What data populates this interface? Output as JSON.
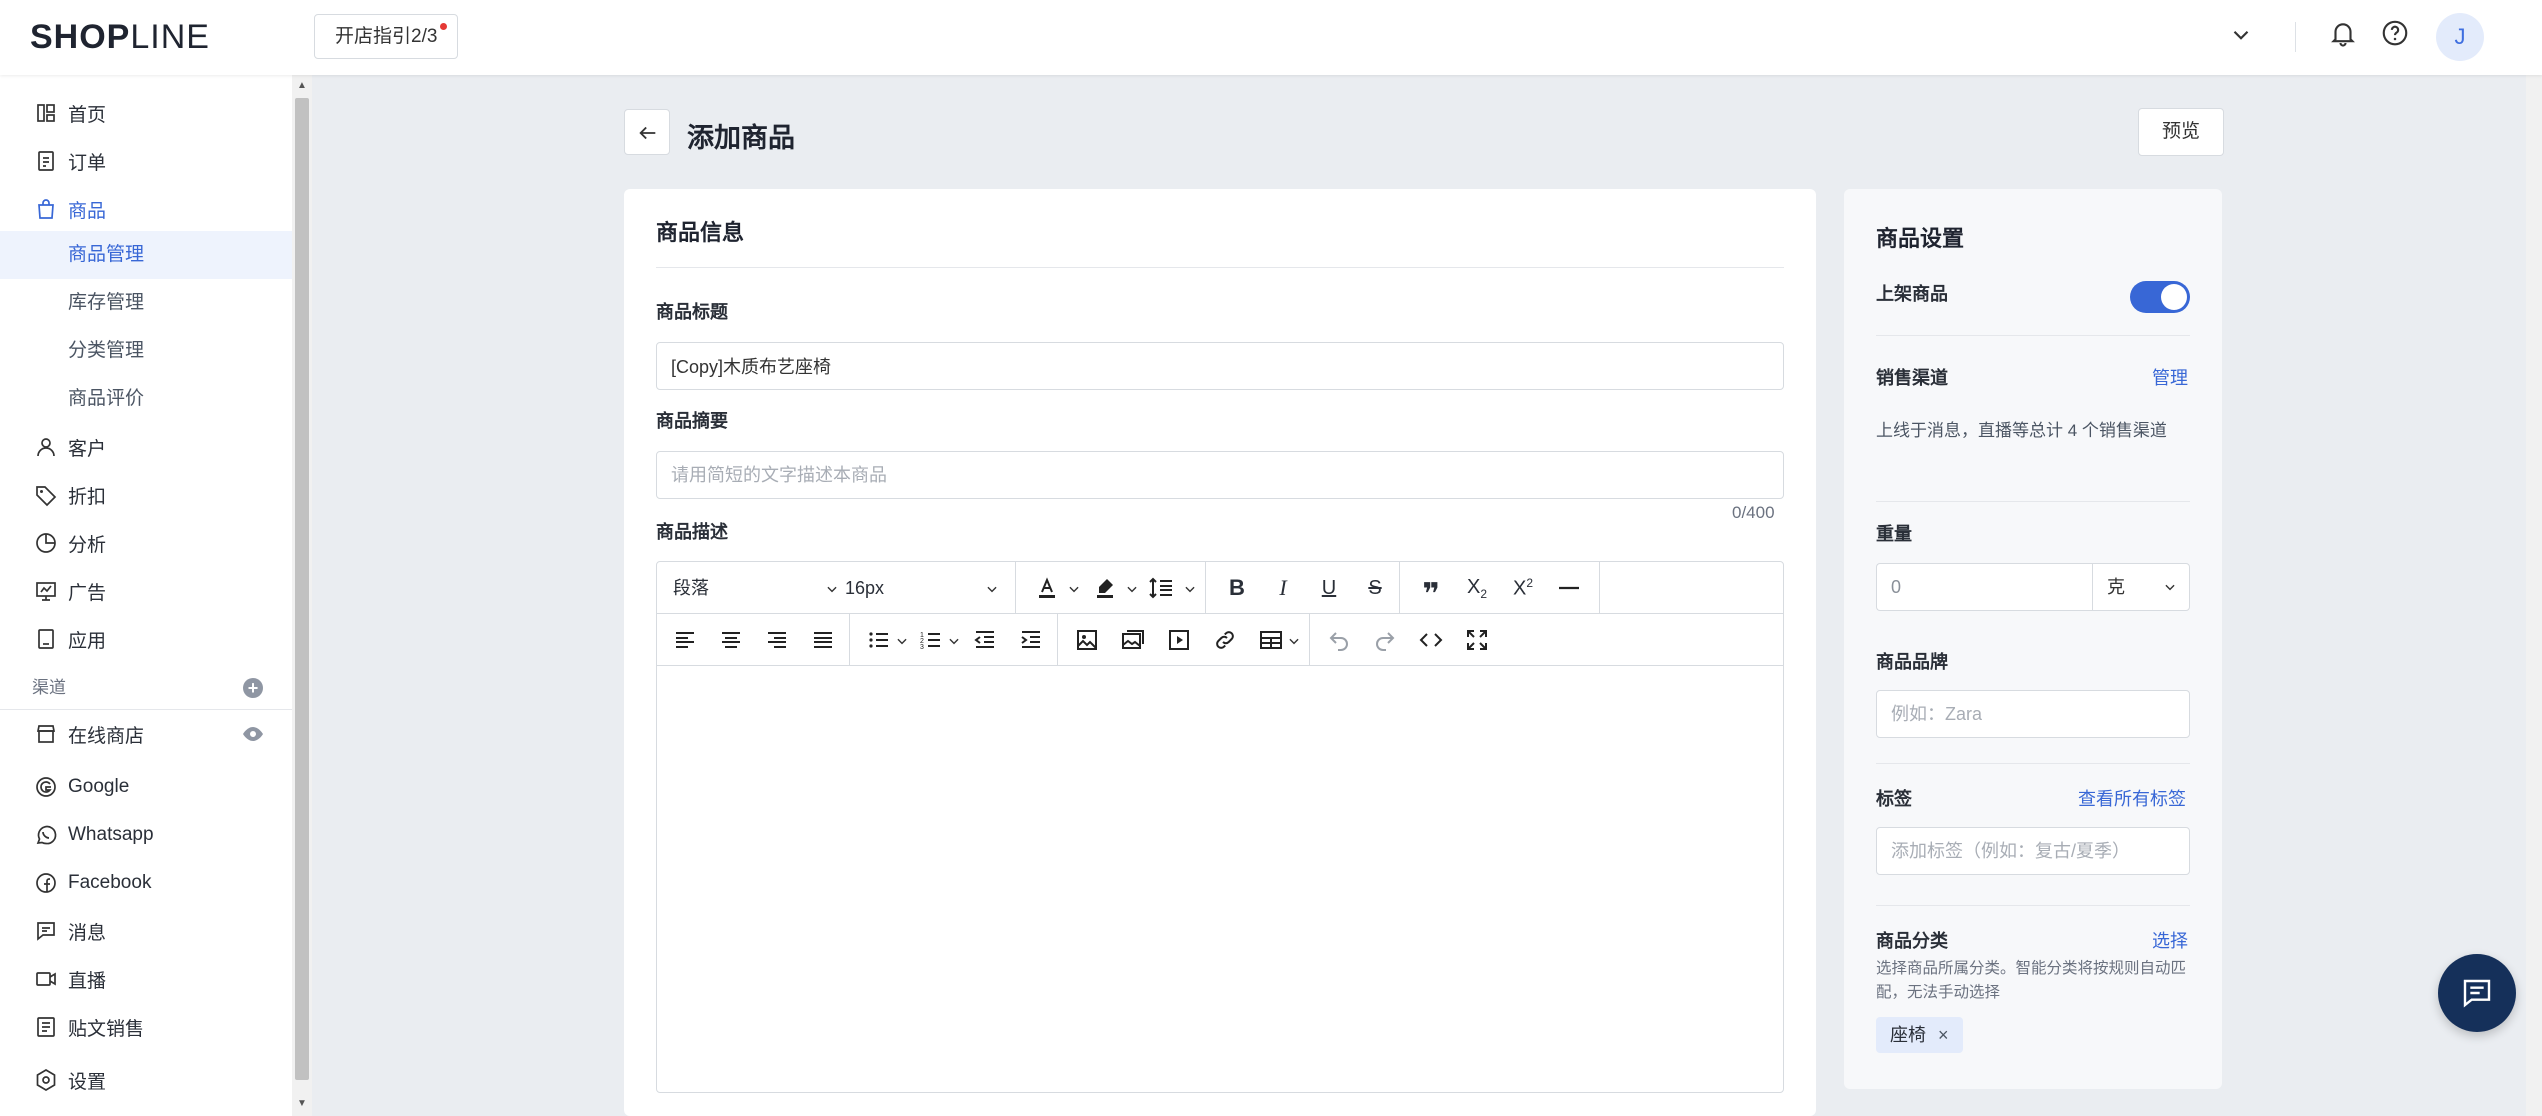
{
  "header": {
    "logo_bold": "SHOP",
    "logo_light": "LINE",
    "guide_button": "开店指引2/3",
    "avatar_initial": "J"
  },
  "sidebar": {
    "items": [
      {
        "label": "首页",
        "icon": "dashboard-icon"
      },
      {
        "label": "订单",
        "icon": "order-icon"
      },
      {
        "label": "商品",
        "icon": "bag-icon",
        "active": true
      }
    ],
    "product_sub": [
      {
        "label": "商品管理",
        "active": true
      },
      {
        "label": "库存管理"
      },
      {
        "label": "分类管理"
      },
      {
        "label": "商品评价"
      }
    ],
    "items2": [
      {
        "label": "客户",
        "icon": "user-icon"
      },
      {
        "label": "折扣",
        "icon": "tag-icon"
      },
      {
        "label": "分析",
        "icon": "pie-chart-icon"
      },
      {
        "label": "广告",
        "icon": "ads-icon"
      },
      {
        "label": "应用",
        "icon": "app-icon"
      }
    ],
    "channel_section": "渠道",
    "channels": [
      {
        "label": "在线商店",
        "icon": "store-icon"
      },
      {
        "label": "Google",
        "icon": "google-icon"
      },
      {
        "label": "Whatsapp",
        "icon": "whatsapp-icon"
      },
      {
        "label": "Facebook",
        "icon": "facebook-icon"
      },
      {
        "label": "消息",
        "icon": "message-icon"
      },
      {
        "label": "直播",
        "icon": "live-icon"
      },
      {
        "label": "贴文销售",
        "icon": "post-icon"
      }
    ],
    "settings": "设置"
  },
  "page": {
    "title": "添加商品",
    "preview_button": "预览"
  },
  "main": {
    "card_title": "商品信息",
    "title_label": "商品标题",
    "title_value": "[Copy]木质布艺座椅",
    "summary_label": "商品摘要",
    "summary_placeholder": "请用简短的文字描述本商品",
    "summary_counter": "0/400",
    "desc_label": "商品描述",
    "editor": {
      "paragraph_select": "段落",
      "font_size_select": "16px"
    }
  },
  "side": {
    "title": "商品设置",
    "publish_label": "上架商品",
    "publish_on": true,
    "channels_label": "销售渠道",
    "channels_link": "管理",
    "channels_desc": "上线于消息，直播等总计 4 个销售渠道",
    "weight_label": "重量",
    "weight_value": "0",
    "weight_unit": "克",
    "brand_label": "商品品牌",
    "brand_placeholder": "例如：Zara",
    "tags_label": "标签",
    "tags_link": "查看所有标签",
    "tags_placeholder": "添加标签（例如：复古/夏季）",
    "category_label": "商品分类",
    "category_link": "选择",
    "category_desc": "选择商品所属分类。智能分类将按规则自动匹配，无法手动选择",
    "category_chip": "座椅",
    "chip_close": "×"
  },
  "colors": {
    "accent": "#3867d6",
    "page_bg": "#eaedf1",
    "chat_fab": "#15305a"
  }
}
